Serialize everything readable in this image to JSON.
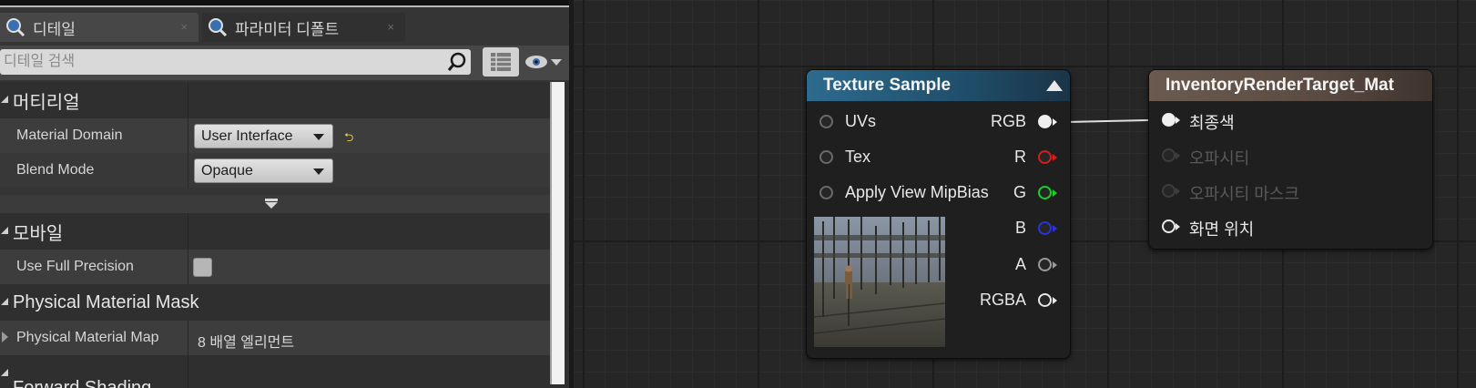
{
  "tabs": {
    "details": "디테일",
    "param_defaults": "파라미터 디폴트",
    "close_glyph": "×"
  },
  "search": {
    "placeholder": "디테일 검색"
  },
  "categories": {
    "material": "머티리얼",
    "mobile": "모바일",
    "phys_mask": "Physical Material Mask",
    "surface": "Forward Shading"
  },
  "properties": {
    "material_domain": {
      "label": "Material Domain",
      "value": "User Interface"
    },
    "blend_mode": {
      "label": "Blend Mode",
      "value": "Opaque"
    },
    "use_full_precision": {
      "label": "Use Full Precision",
      "checked": false
    },
    "phys_mat_map": {
      "label": "Physical Material Map",
      "value": "8 배열 엘리먼트"
    }
  },
  "reset_glyph": "⮌",
  "nodes": {
    "texture_sample": {
      "title": "Texture Sample",
      "inputs": [
        "UVs",
        "Tex",
        "Apply View MipBias"
      ],
      "outputs": [
        {
          "label": "RGB",
          "color": "#f0f0f0"
        },
        {
          "label": "R",
          "color": "#d91c1c"
        },
        {
          "label": "G",
          "color": "#1ecf2b"
        },
        {
          "label": "B",
          "color": "#2a32e0"
        },
        {
          "label": "A",
          "color": "#9a9a9a"
        },
        {
          "label": "RGBA",
          "color": "#e8e8e8"
        }
      ]
    },
    "material_result": {
      "title": "InventoryRenderTarget_Mat",
      "inputs": [
        {
          "label": "최종색",
          "enabled": true
        },
        {
          "label": "오파시티",
          "enabled": false
        },
        {
          "label": "오파시티 마스크",
          "enabled": false
        },
        {
          "label": "화면 위치",
          "enabled": true
        }
      ]
    }
  },
  "colors": {
    "texture_header": "#2d6b8e",
    "material_header": "#6b5a4f",
    "panel_bg": "#353535"
  }
}
